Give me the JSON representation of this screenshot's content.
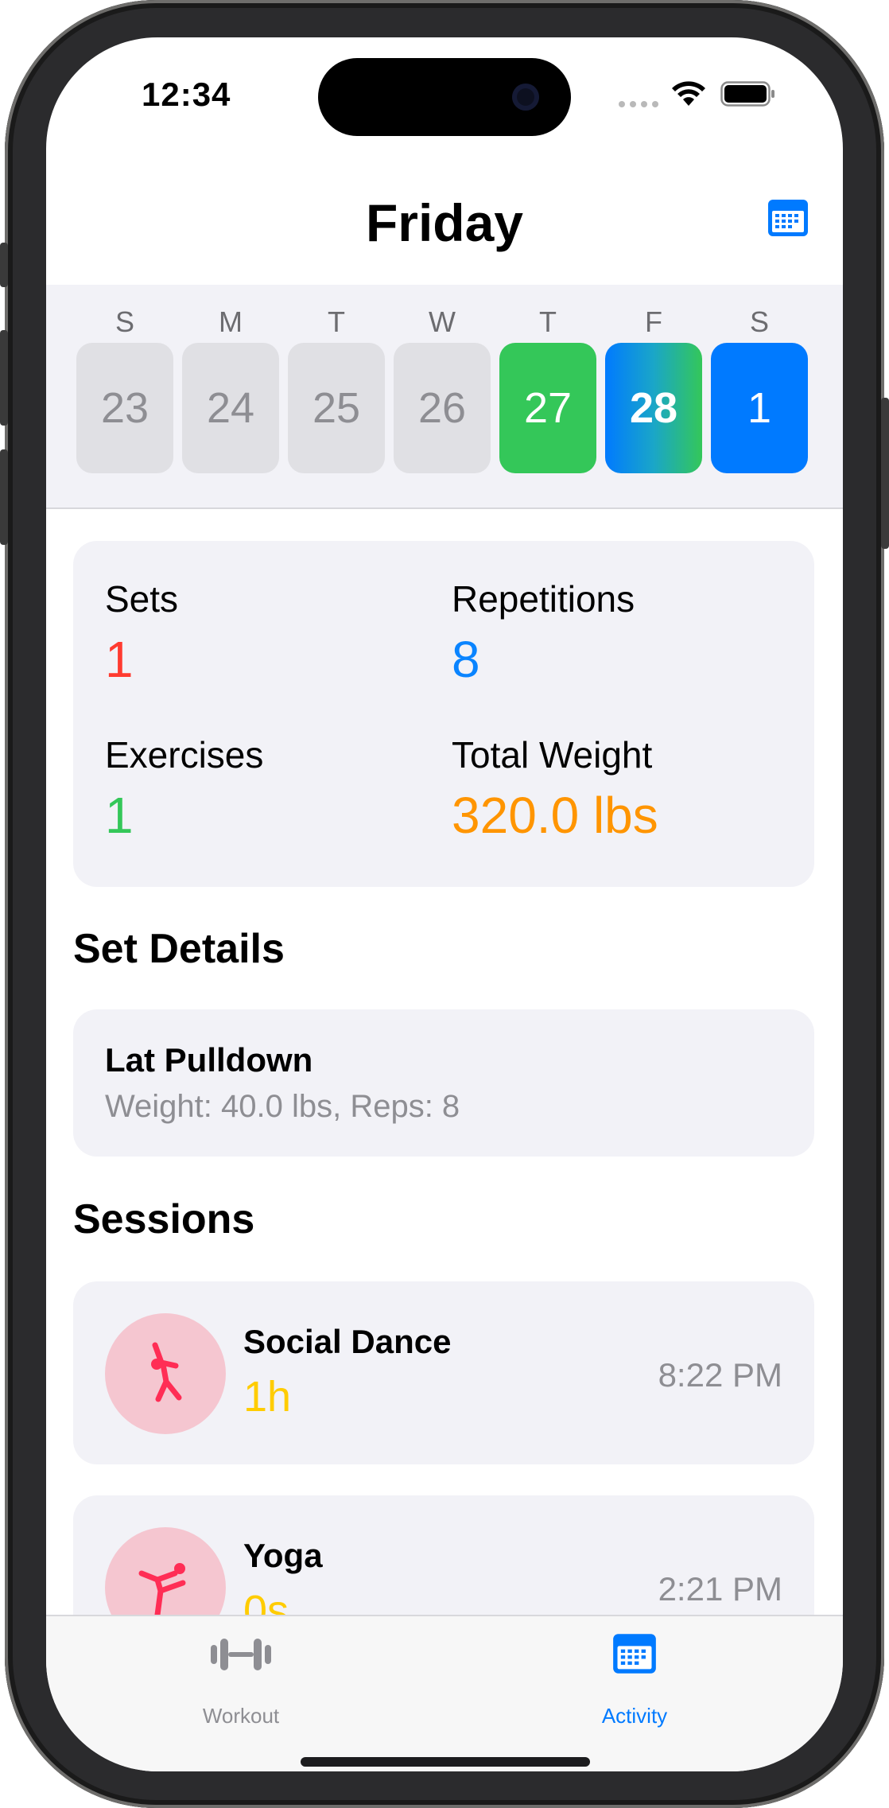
{
  "status_bar": {
    "time": "12:34"
  },
  "header": {
    "title": "Friday"
  },
  "week": {
    "days": [
      {
        "letter": "S",
        "date": "23",
        "state": "empty"
      },
      {
        "letter": "M",
        "date": "24",
        "state": "empty"
      },
      {
        "letter": "T",
        "date": "25",
        "state": "empty"
      },
      {
        "letter": "W",
        "date": "26",
        "state": "empty"
      },
      {
        "letter": "T",
        "date": "27",
        "state": "green"
      },
      {
        "letter": "F",
        "date": "28",
        "state": "selected"
      },
      {
        "letter": "S",
        "date": "1",
        "state": "blue"
      }
    ]
  },
  "stats": {
    "sets_label": "Sets",
    "sets_value": "1",
    "reps_label": "Repetitions",
    "reps_value": "8",
    "exercises_label": "Exercises",
    "exercises_value": "1",
    "weight_label": "Total Weight",
    "weight_value": "320.0 lbs"
  },
  "set_details": {
    "title": "Set Details",
    "items": [
      {
        "name": "Lat Pulldown",
        "detail": "Weight: 40.0 lbs, Reps: 8"
      }
    ]
  },
  "sessions": {
    "title": "Sessions",
    "items": [
      {
        "name": "Social Dance",
        "duration": "1h",
        "time": "8:22 PM",
        "icon": "dance-icon"
      },
      {
        "name": "Yoga",
        "duration": "0s",
        "time": "2:21 PM",
        "icon": "yoga-icon"
      }
    ]
  },
  "tab_bar": {
    "workout_label": "Workout",
    "activity_label": "Activity",
    "active": "activity"
  },
  "colors": {
    "accent": "#007aff",
    "red": "#ff3b30",
    "green": "#34c759",
    "orange": "#ff9500",
    "yellow": "#ffcc00",
    "session_icon_bg": "#f5c6d0",
    "session_icon_fg": "#ff2d55"
  }
}
